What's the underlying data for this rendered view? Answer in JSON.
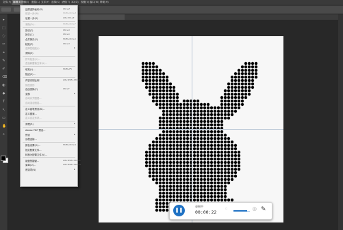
{
  "menubar": {
    "items": [
      "文件(F)",
      "编辑(E)",
      "图像(I)",
      "图层(L)",
      "文字(Y)",
      "选择(S)",
      "滤镜(T)",
      "3D(D)",
      "视图(V)",
      "窗口(W)",
      "帮助(H)"
    ]
  },
  "edit_menu": {
    "items": [
      {
        "label": "还原选择画布(O)",
        "shortcut": "Ctrl+Z",
        "disabled": false
      },
      {
        "label": "前进一步(W)",
        "shortcut": "Shift+Ctrl+Z",
        "disabled": true
      },
      {
        "label": "后退一步(K)",
        "shortcut": "Alt+Ctrl+Z",
        "disabled": false
      },
      {
        "label": "渐隐(D)...",
        "shortcut": "Shift+Ctrl+F",
        "disabled": true
      },
      {
        "label": "剪切(T)",
        "shortcut": "Ctrl+X",
        "disabled": false
      },
      {
        "label": "拷贝(C)",
        "shortcut": "Ctrl+C",
        "disabled": false
      },
      {
        "label": "合并拷贝(Y)",
        "shortcut": "Shift+Ctrl+C",
        "disabled": false
      },
      {
        "label": "粘贴(P)",
        "shortcut": "Ctrl+V",
        "disabled": false
      },
      {
        "label": "选择性粘贴(I)",
        "shortcut": "",
        "disabled": true,
        "submenu": true
      },
      {
        "label": "清除(E)",
        "shortcut": "",
        "disabled": false
      },
      {
        "label": "拼写检查(H)...",
        "shortcut": "",
        "disabled": true
      },
      {
        "label": "查找和替换文本(X)...",
        "shortcut": "",
        "disabled": true
      },
      {
        "label": "填充(L)...",
        "shortcut": "Shift+F5",
        "disabled": false
      },
      {
        "label": "描边(S)...",
        "shortcut": "",
        "disabled": false
      },
      {
        "label": "内容识别比例",
        "shortcut": "Alt+Shift+Ctrl+C",
        "disabled": false
      },
      {
        "label": "操控变形",
        "shortcut": "",
        "disabled": true
      },
      {
        "label": "自由变换(F)",
        "shortcut": "Ctrl+T",
        "disabled": false
      },
      {
        "label": "变换",
        "shortcut": "",
        "disabled": false,
        "submenu": true
      },
      {
        "label": "自动对齐图层...",
        "shortcut": "",
        "disabled": true
      },
      {
        "label": "自动混合图层...",
        "shortcut": "",
        "disabled": true
      },
      {
        "label": "定义画笔预设(B)...",
        "shortcut": "",
        "disabled": false
      },
      {
        "label": "定义图案...",
        "shortcut": "",
        "disabled": false
      },
      {
        "label": "定义自定形状...",
        "shortcut": "",
        "disabled": true
      },
      {
        "label": "清理(R)",
        "shortcut": "",
        "disabled": false,
        "submenu": true
      },
      {
        "label": "Adobe PDF 预设...",
        "shortcut": "",
        "disabled": false
      },
      {
        "label": "预设",
        "shortcut": "",
        "disabled": false,
        "submenu": true
      },
      {
        "label": "远程连接...",
        "shortcut": "",
        "disabled": false
      },
      {
        "label": "颜色设置(G)...",
        "shortcut": "Shift+Ctrl+K",
        "disabled": false
      },
      {
        "label": "指定配置文件...",
        "shortcut": "",
        "disabled": false
      },
      {
        "label": "转换为配置文件(V)...",
        "shortcut": "",
        "disabled": false
      },
      {
        "label": "键盘快捷键...",
        "shortcut": "Alt+Shift+Ctrl+K",
        "disabled": false
      },
      {
        "label": "菜单(U)...",
        "shortcut": "Alt+Shift+Ctrl+M",
        "disabled": false
      },
      {
        "label": "首选项(N)",
        "shortcut": "",
        "disabled": false,
        "submenu": true
      }
    ]
  },
  "recorder": {
    "status_label": "录制中",
    "time": "00:00:22",
    "play_icon": "pause-icon",
    "accent": "#1f72c4"
  },
  "canvas": {
    "background": "#f7f7f7",
    "dot_color": "#000000",
    "content": "rabbit silhouette made of black dots"
  },
  "colors": {
    "foreground": "#000000",
    "background": "#ffffff"
  }
}
